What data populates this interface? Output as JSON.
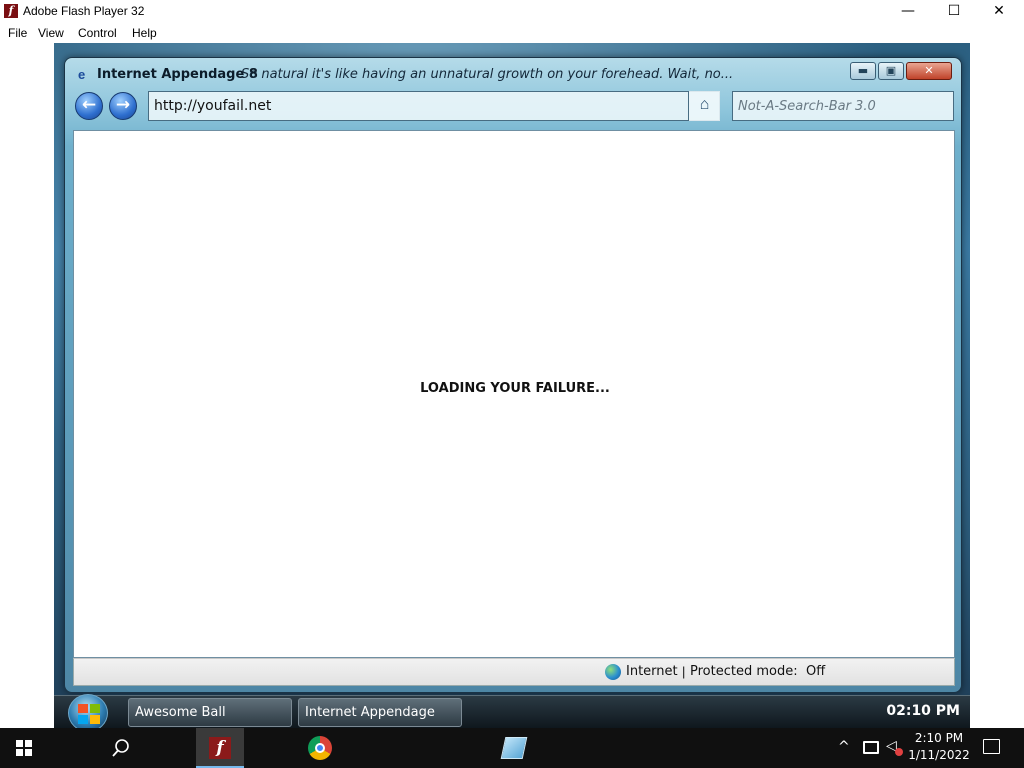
{
  "flash_window": {
    "title": "Adobe Flash Player 32",
    "logo_glyph": "f",
    "controls": {
      "minimize": "—",
      "maximize": "☐",
      "close": "✕"
    },
    "menu": [
      "File",
      "View",
      "Control",
      "Help"
    ]
  },
  "browser": {
    "title": "Internet Appendage 8",
    "tagline": "So natural it's like having an unnatural growth on your forehead.  Wait, no...",
    "address": "http://youfail.net",
    "search_placeholder": "Not-A-Search-Bar 3.0",
    "content_message": "LOADING YOUR FAILURE...",
    "status": {
      "zone": "Internet",
      "separator": "|",
      "protected_label": "Protected mode:",
      "protected_value": "Off"
    },
    "caption_buttons": {
      "minimize": "▬",
      "maximize": "▣",
      "close": "✕"
    }
  },
  "inner_taskbar": {
    "tasks": [
      "Awesome Ball",
      "Internet Appendage"
    ],
    "clock": "02:10 PM"
  },
  "taskbar": {
    "time": "2:10 PM",
    "date": "1/11/2022",
    "pinned_icons": [
      "start-icon",
      "search-icon",
      "file-explorer-icon",
      "chrome-icon",
      "flash-player-icon",
      "notepad-icon"
    ],
    "accent_color": "#76b9ed"
  }
}
